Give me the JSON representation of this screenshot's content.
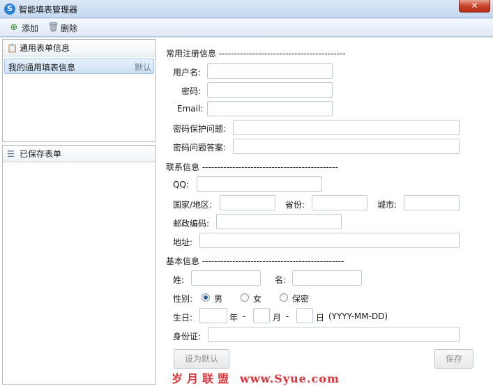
{
  "window": {
    "title": "智能填表管理器",
    "close": "✕"
  },
  "toolbar": {
    "add_label": "添加",
    "delete_label": "删除"
  },
  "left": {
    "general_header": "通用表单信息",
    "general_item": {
      "name": "我的通用填表信息",
      "tag": "默认"
    },
    "saved_header": "已保存表单"
  },
  "form": {
    "section_register": "常用注册信息 ------------------------------------------",
    "username_label": "用户名:",
    "password_label": "密码:",
    "email_label": "Email:",
    "security_question_label": "密码保护问题:",
    "security_answer_label": "密码问题答案:",
    "section_contact": "联系信息 ---------------------------------------------",
    "qq_label": "QQ:",
    "country_label": "国家/地区:",
    "province_label": "省份:",
    "city_label": "城市:",
    "postcode_label": "邮政编码:",
    "address_label": "地址:",
    "section_basic": "基本信息 -----------------------------------------------",
    "lastname_label": "姓:",
    "firstname_label": "名:",
    "gender_label": "性别:",
    "gender_male": "男",
    "gender_female": "女",
    "gender_secret": "保密",
    "birthday_label": "生日:",
    "year_label": "年",
    "dash": "-",
    "month_label": "月",
    "day_label": "日",
    "date_format": "(YYYY-MM-DD)",
    "id_label": "身份证:",
    "set_default_button": "设为默认",
    "save_button": "保存"
  },
  "watermark": {
    "text": "岁月联盟",
    "url": "www.Syue.com"
  }
}
